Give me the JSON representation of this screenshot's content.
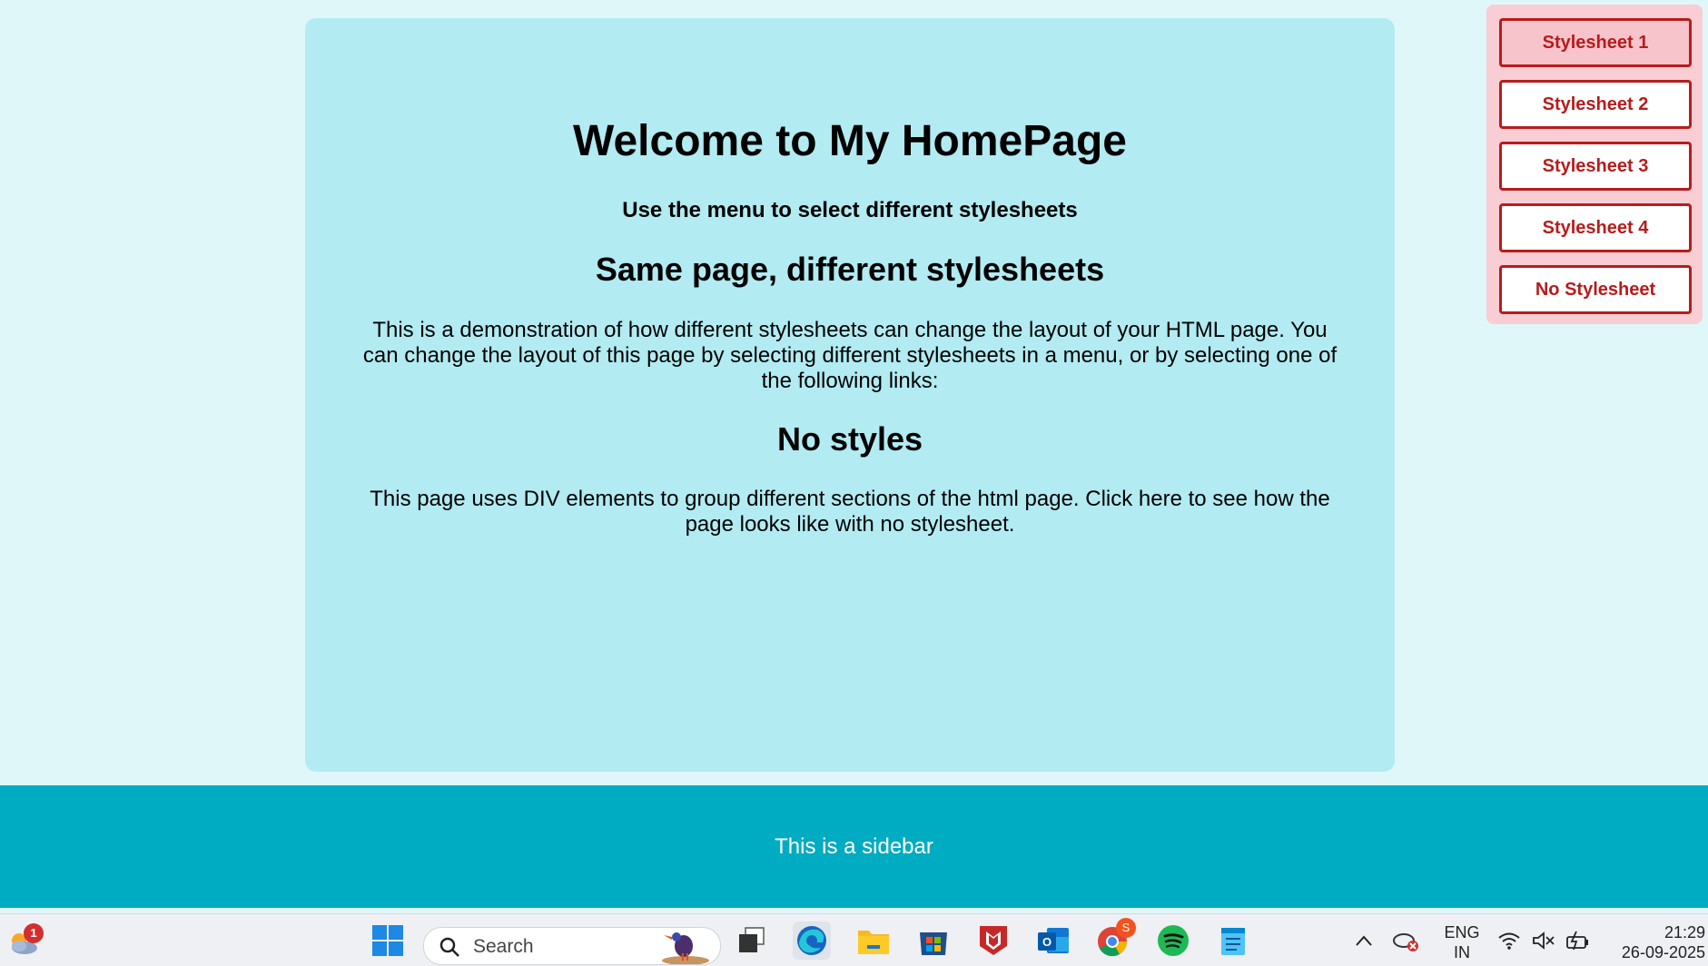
{
  "main": {
    "title": "Welcome to My HomePage",
    "subtitle": "Use the menu to select different stylesheets",
    "section1_heading": "Same page, different stylesheets",
    "section1_text": "This is a demonstration of how different stylesheets can change the layout of your HTML page. You can change the layout of this page by selecting different stylesheets in a menu, or by selecting one of the following links:",
    "section2_heading": "No styles",
    "section2_text": "This page uses DIV elements to group different sections of the html page. Click here to see how the page looks like with no stylesheet."
  },
  "menu": {
    "items": [
      {
        "label": "Stylesheet 1",
        "active": true
      },
      {
        "label": "Stylesheet 2",
        "active": false
      },
      {
        "label": "Stylesheet 3",
        "active": false
      },
      {
        "label": "Stylesheet 4",
        "active": false
      },
      {
        "label": "No Stylesheet",
        "active": false
      }
    ]
  },
  "sidebar": {
    "text": "This is a sidebar"
  },
  "taskbar": {
    "weather_badge": "1",
    "search_placeholder": "Search",
    "chrome_badge": "S",
    "language": "ENG",
    "region": "IN",
    "time": "21:29",
    "date": "26-09-2025",
    "icons": [
      "weather-icon",
      "windows-start-icon",
      "search-icon",
      "task-view-icon",
      "edge-icon",
      "file-explorer-icon",
      "microsoft-store-icon",
      "mcafee-icon",
      "outlook-icon",
      "chrome-icon",
      "spotify-icon",
      "notepad-icon",
      "chevron-up-icon",
      "onedrive-icon",
      "wifi-icon",
      "volume-muted-icon",
      "battery-icon"
    ]
  },
  "colors": {
    "page_bg": "#e0f7fa",
    "card_bg": "#b2ebf2",
    "menu_bg": "#f8cdd3",
    "menu_accent": "#b71c1c",
    "sidebar_bg": "#00acc1"
  }
}
